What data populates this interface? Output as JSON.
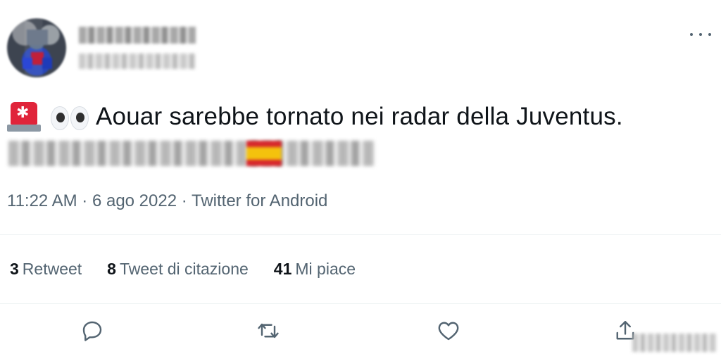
{
  "tweet": {
    "text": "Aouar sarebbe tornato nei radar della Juventus.",
    "emojis": [
      "police-car-light",
      "eyes"
    ],
    "source_flag": "spain-flag"
  },
  "meta": {
    "time": "11:22 AM",
    "sep1": " · ",
    "date": "6 ago 2022",
    "sep2": " · ",
    "source": "Twitter for Android"
  },
  "stats": {
    "retweets_count": "3",
    "retweets_label": "Retweet",
    "quotes_count": "8",
    "quotes_label": "Tweet di citazione",
    "likes_count": "41",
    "likes_label": "Mi piace"
  },
  "actions": {
    "icons": [
      "reply-icon",
      "retweet-icon",
      "like-icon",
      "share-icon"
    ]
  },
  "colors": {
    "text": "#0f1419",
    "secondary": "#536471",
    "divider": "#eff3f4"
  }
}
